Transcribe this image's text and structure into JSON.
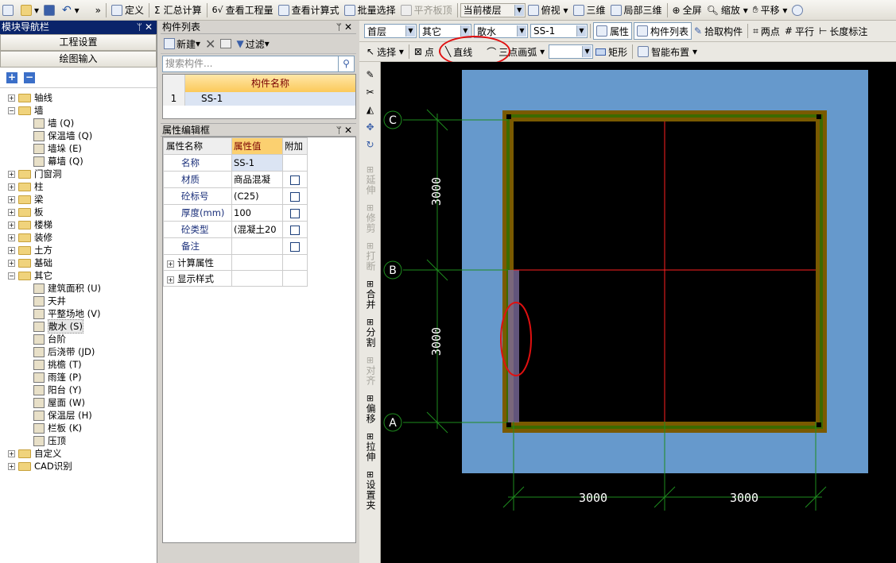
{
  "toolbar1": {
    "items": [
      "定义",
      "汇总计算",
      "查看工程量",
      "查看计算式",
      "批量选择",
      "平齐板顶"
    ],
    "current_floor_label": "当前楼层",
    "view_items": [
      "俯视",
      "三维",
      "局部三维",
      "全屏",
      "缩放",
      "平移"
    ]
  },
  "toolbar2": {
    "floor": "首层",
    "category": "其它",
    "type": "散水",
    "component": "SS-1",
    "buttons": [
      "属性",
      "构件列表",
      "拾取构件",
      "两点",
      "平行",
      "长度标注"
    ]
  },
  "toolbar3": {
    "select": "选择",
    "point": "点",
    "line": "直线",
    "arc": "三点画弧",
    "rect": "矩形",
    "smart": "智能布置"
  },
  "leftpanel": {
    "title": "模块导航栏",
    "btn_project": "工程设置",
    "btn_draw": "绘图输入",
    "tree": [
      {
        "label": "轴线",
        "type": "folder",
        "expand": "+"
      },
      {
        "label": "墙",
        "type": "folder",
        "expand": "-"
      },
      {
        "label": "墙 (Q)",
        "type": "leaf"
      },
      {
        "label": "保温墙 (Q)",
        "type": "leaf"
      },
      {
        "label": "墙垛 (E)",
        "type": "leaf"
      },
      {
        "label": "幕墙 (Q)",
        "type": "leaf"
      },
      {
        "label": "门窗洞",
        "type": "folder",
        "expand": "+"
      },
      {
        "label": "柱",
        "type": "folder",
        "expand": "+"
      },
      {
        "label": "梁",
        "type": "folder",
        "expand": "+"
      },
      {
        "label": "板",
        "type": "folder",
        "expand": "+"
      },
      {
        "label": "楼梯",
        "type": "folder",
        "expand": "+"
      },
      {
        "label": "装修",
        "type": "folder",
        "expand": "+"
      },
      {
        "label": "土方",
        "type": "folder",
        "expand": "+"
      },
      {
        "label": "基础",
        "type": "folder",
        "expand": "+"
      },
      {
        "label": "其它",
        "type": "folder",
        "expand": "-"
      },
      {
        "label": "建筑面积 (U)",
        "type": "leaf"
      },
      {
        "label": "天井",
        "type": "leaf"
      },
      {
        "label": "平整场地 (V)",
        "type": "leaf"
      },
      {
        "label": "散水 (S)",
        "type": "leaf",
        "selected": true
      },
      {
        "label": "台阶",
        "type": "leaf"
      },
      {
        "label": "后浇带 (JD)",
        "type": "leaf"
      },
      {
        "label": "挑檐 (T)",
        "type": "leaf"
      },
      {
        "label": "雨篷 (P)",
        "type": "leaf"
      },
      {
        "label": "阳台 (Y)",
        "type": "leaf"
      },
      {
        "label": "屋面 (W)",
        "type": "leaf"
      },
      {
        "label": "保温层 (H)",
        "type": "leaf"
      },
      {
        "label": "栏板 (K)",
        "type": "leaf"
      },
      {
        "label": "压顶",
        "type": "leaf"
      },
      {
        "label": "自定义",
        "type": "folder",
        "expand": "+"
      },
      {
        "label": "CAD识别",
        "type": "folder",
        "expand": "+"
      }
    ]
  },
  "complist": {
    "title": "构件列表",
    "new_btn": "新建",
    "filter_btn": "过滤",
    "search_placeholder": "搜索构件...",
    "col_header": "构件名称",
    "rows": [
      {
        "idx": "1",
        "name": "SS-1"
      }
    ]
  },
  "propeditor": {
    "title": "属性编辑框",
    "headers": [
      "属性名称",
      "属性值",
      "附加"
    ],
    "rows": [
      {
        "name": "名称",
        "value": "SS-1",
        "check": false
      },
      {
        "name": "材质",
        "value": "商品混凝",
        "check": true
      },
      {
        "name": "砼标号",
        "value": "(C25)",
        "check": true
      },
      {
        "name": "厚度(mm)",
        "value": "100",
        "check": true
      },
      {
        "name": "砼类型",
        "value": "(混凝土20",
        "check": true
      },
      {
        "name": "备注",
        "value": "",
        "check": true
      }
    ],
    "groups": [
      "计算属性",
      "显示样式"
    ]
  },
  "vtools": [
    "延伸",
    "修剪",
    "打断",
    "合并",
    "分割",
    "对齐",
    "偏移",
    "拉伸",
    "设置夹"
  ],
  "drawing": {
    "axes": [
      "C",
      "B",
      "A"
    ],
    "dims_vertical": [
      "3000",
      "3000"
    ],
    "dims_horizontal": [
      "3000",
      "3000"
    ],
    "colors": {
      "slab": "#6699cc",
      "wall_outer": "#7a5a00",
      "wall_inner": "#3c6a00",
      "axis": "#ff2020",
      "dim": "#1e8c1e"
    }
  }
}
